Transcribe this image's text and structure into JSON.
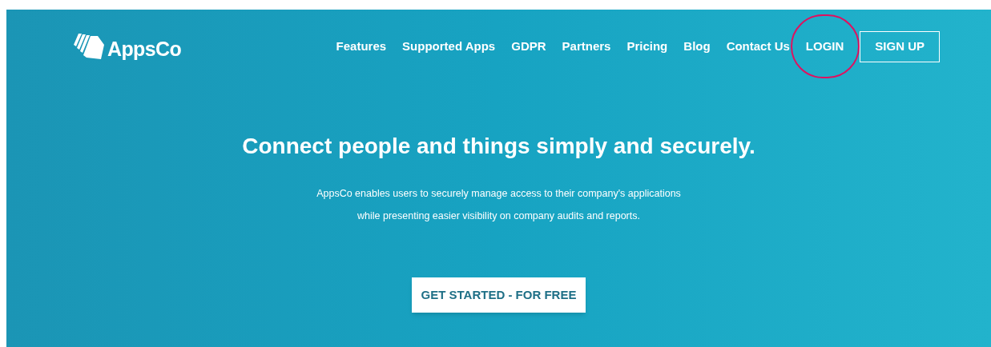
{
  "header": {
    "logo": "AppsCo",
    "nav": [
      {
        "label": "Features",
        "kind": "link",
        "circled": false
      },
      {
        "label": "Supported Apps",
        "kind": "link",
        "circled": false
      },
      {
        "label": "GDPR",
        "kind": "link",
        "circled": false
      },
      {
        "label": "Partners",
        "kind": "link",
        "circled": false
      },
      {
        "label": "Pricing",
        "kind": "link",
        "circled": false
      },
      {
        "label": "Blog",
        "kind": "link",
        "circled": false
      },
      {
        "label": "Contact Us",
        "kind": "link",
        "circled": false
      },
      {
        "label": "LOGIN",
        "kind": "link",
        "circled": true
      },
      {
        "label": "SIGN UP",
        "kind": "outlined",
        "circled": false
      }
    ]
  },
  "hero": {
    "headline": "Connect people and things simply and securely.",
    "lines": [
      "AppsCo enables users to securely manage access to their company's applications",
      "while presenting easier visibility on company audits and reports."
    ],
    "cta": "GET STARTED - FOR FREE"
  }
}
